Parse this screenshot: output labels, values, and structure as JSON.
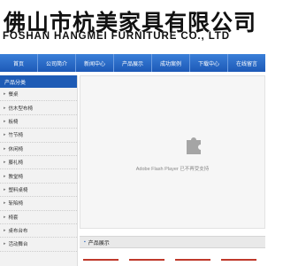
{
  "header": {
    "company_cn": "佛山市杭美家具有限公司",
    "company_en": "FOSHAN HANGMEI FURNITURE CO., LTD"
  },
  "nav": {
    "items": [
      "首页",
      "公司简介",
      "新闻中心",
      "产品展示",
      "成功案例",
      "下载中心",
      "在线留言"
    ]
  },
  "sidebar": {
    "title": "产品分类",
    "items": [
      "餐桌",
      "仿木型布椅",
      "板椅",
      "竹节椅",
      "休闲椅",
      "藤礼椅",
      "教堂椅",
      "塑料桌椅",
      "斩陷椅",
      "椅套",
      "桌布台布",
      "活动舞台"
    ]
  },
  "flash": {
    "message": "Adobe Flash Player 已不再受支持"
  },
  "products": {
    "title": "产品展示"
  },
  "colors": {
    "nav_blue": "#1d59b7",
    "sidebar_header": "#1e5bb5",
    "thumb_accent": "#c0392b"
  }
}
